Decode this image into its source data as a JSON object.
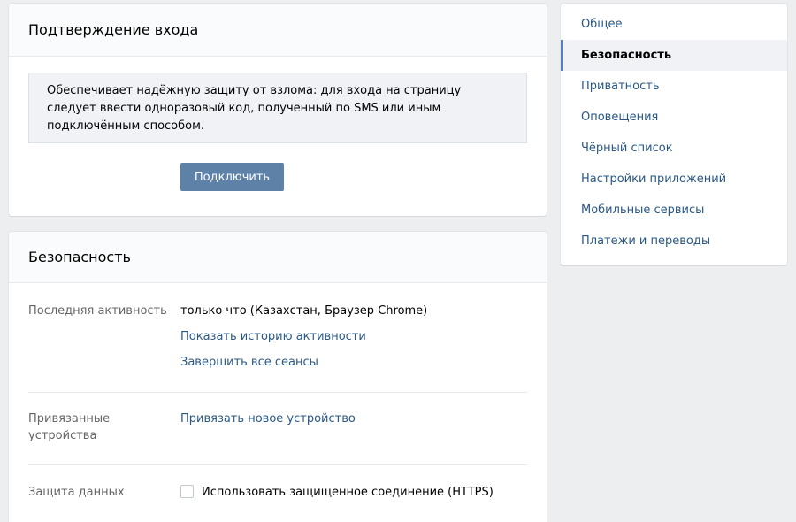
{
  "two_factor": {
    "title": "Подтверждение входа",
    "description": "Обеспечивает надёжную защиту от взлома: для входа на страницу следует ввести одноразовый код, полученный по SMS или иным подключённым способом.",
    "connect_button": "Подключить"
  },
  "security": {
    "title": "Безопасность",
    "last_activity": {
      "label": "Последняя активность",
      "value": "только что (Казахстан, Браузер Chrome)",
      "show_history": "Показать историю активности",
      "end_sessions": "Завершить все сеансы"
    },
    "devices": {
      "label": "Привязанные устройства",
      "link": "Привязать новое устройство"
    },
    "data_protection": {
      "label": "Защита данных",
      "checkbox_label": "Использовать защищенное соединение (HTTPS)",
      "checked": false
    }
  },
  "nav": {
    "items": [
      {
        "label": "Общее"
      },
      {
        "label": "Безопасность",
        "active": true
      },
      {
        "label": "Приватность"
      },
      {
        "label": "Оповещения"
      },
      {
        "label": "Чёрный список"
      },
      {
        "label": "Настройки приложений"
      },
      {
        "label": "Мобильные сервисы"
      },
      {
        "label": "Платежи и переводы"
      }
    ]
  },
  "colors": {
    "page_bg": "#edeef0",
    "link": "#2a5885",
    "button": "#5e81a8",
    "active_marker": "#5181b8"
  }
}
